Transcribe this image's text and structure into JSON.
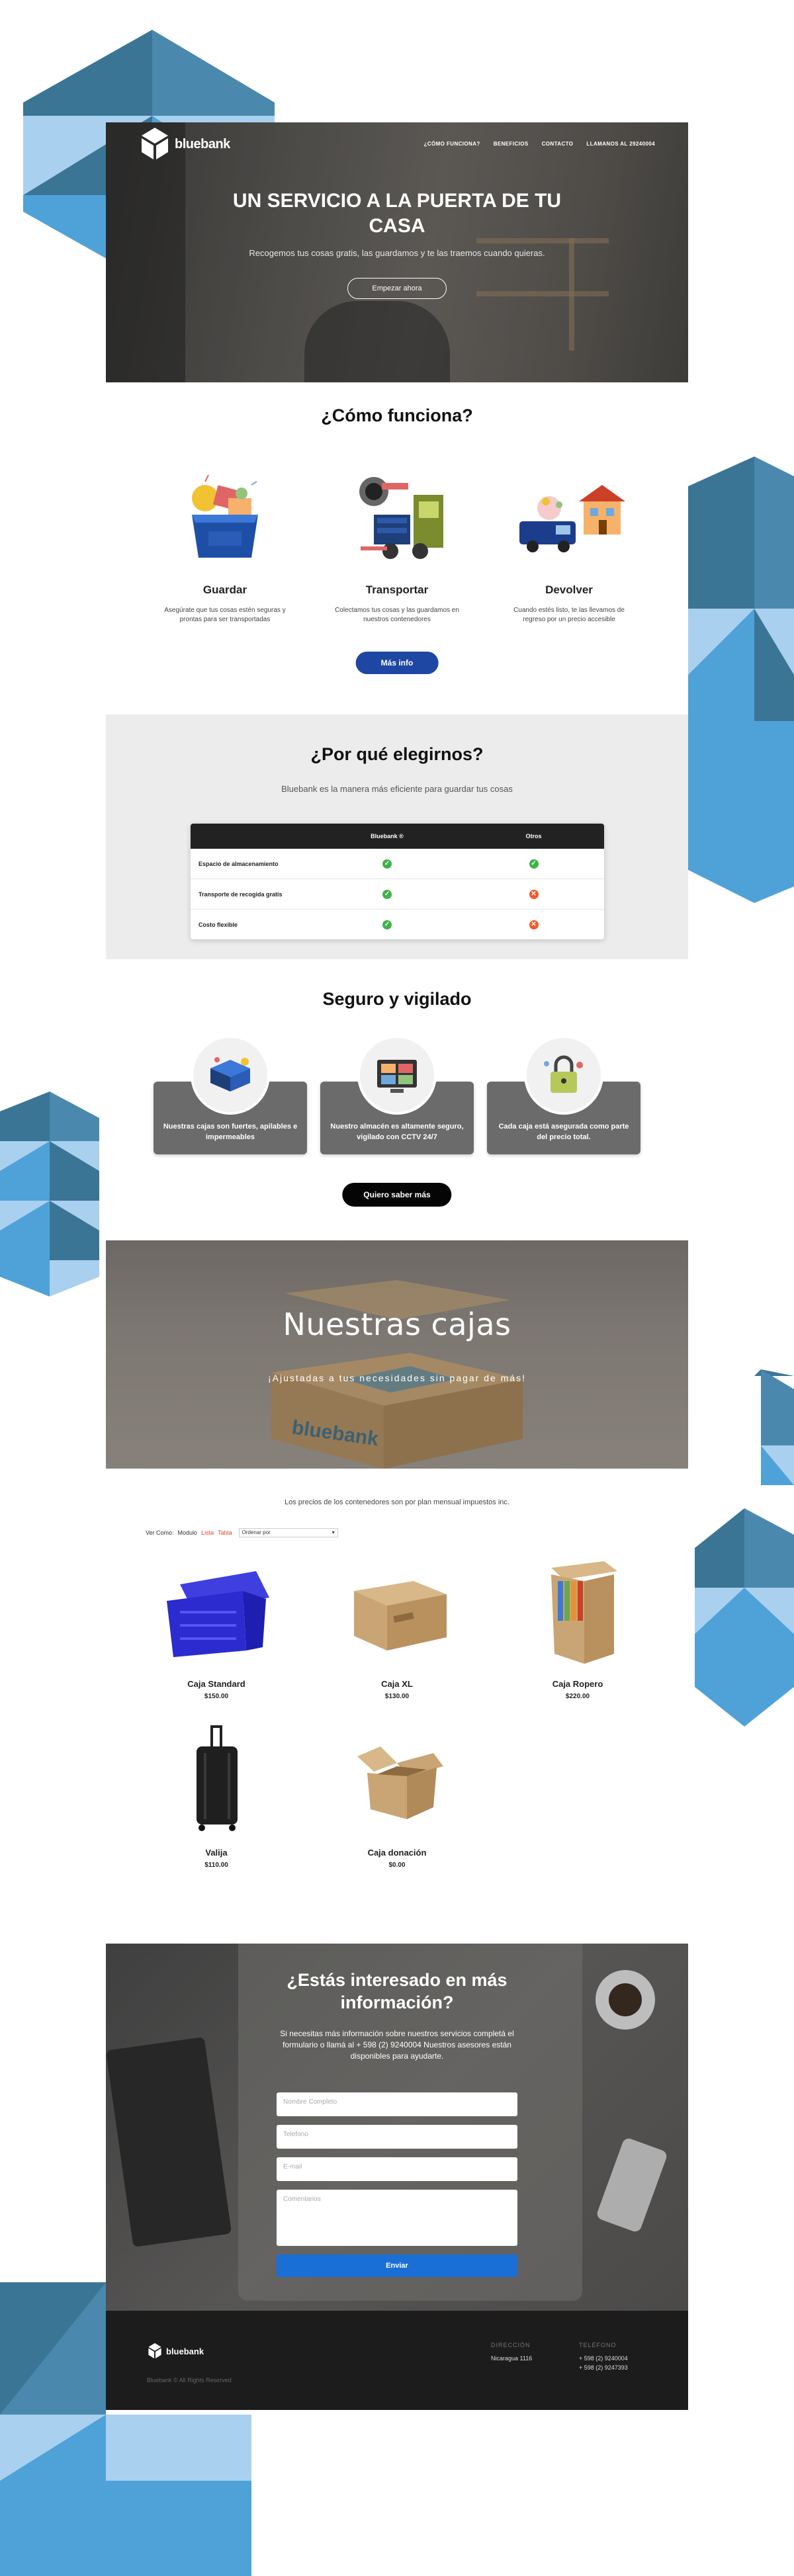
{
  "brand": {
    "name": "bluebank"
  },
  "nav": {
    "items": [
      "¿CÓMO FUNCIONA?",
      "BENEFICIOS",
      "CONTACTO",
      "LLAMANOS AL 29240004"
    ]
  },
  "hero": {
    "title": "UN SERVICIO A LA PUERTA DE TU CASA",
    "subtitle": "Recogemos tus cosas gratis, las guardamos y te las traemos cuando quieras.",
    "cta": "Empezar ahora"
  },
  "how": {
    "title": "¿Cómo funciona?",
    "steps": [
      {
        "title": "Guardar",
        "text": "Asegúrate que tus cosas estén seguras y prontas para ser transportadas"
      },
      {
        "title": "Transportar",
        "text": "Colectamos tus cosas y las guardamos en nuestros contenedores"
      },
      {
        "title": "Devolver",
        "text": "Cuando estés listo, te las llevamos de regreso por un precio accesible"
      }
    ],
    "cta": "Más info"
  },
  "why": {
    "title": "¿Por qué elegirnos?",
    "subtitle": "Bluebank es la manera más eficiente para guardar tus cosas",
    "columns": [
      "",
      "Bluebank ®",
      "Otros"
    ],
    "rows": [
      {
        "label": "Espacio de almacenamiento",
        "bluebank": true,
        "otros": true
      },
      {
        "label": "Transporte de recogida gratis",
        "bluebank": true,
        "otros": false
      },
      {
        "label": "Costo flexible",
        "bluebank": true,
        "otros": false
      }
    ]
  },
  "secure": {
    "title": "Seguro y vigilado",
    "cards": [
      {
        "text": "Nuestras cajas son fuertes, apilables e impermeables"
      },
      {
        "text": "Nuestro almacén es altamente seguro, vigilado con CCTV 24/7"
      },
      {
        "text": "Cada caja está asegurada como parte del precio total."
      }
    ],
    "cta": "Quiero saber más"
  },
  "boxes": {
    "title": "Nuestras cajas",
    "subtitle": "¡Ajustadas a tus necesidades sin pagar de más!",
    "box_label": "bluebank"
  },
  "shop": {
    "note": "Los precios de los contenedores son por plan mensual impuestos inc.",
    "view_label": "Ver Como:",
    "view_options": [
      "Modulo",
      "Lista",
      "Tabla"
    ],
    "sort_label": "Ordenar por",
    "products": [
      {
        "name": "Caja Standard",
        "price": "$150.00"
      },
      {
        "name": "Caja XL",
        "price": "$130.00"
      },
      {
        "name": "Caja Ropero",
        "price": "$220.00"
      },
      {
        "name": "Valija",
        "price": "$110.00"
      },
      {
        "name": "Caja donación",
        "price": "$0.00"
      }
    ]
  },
  "contact": {
    "title": "¿Estás interesado en más información?",
    "text": "Si necesitas más información sobre nuestros servicios completá el formulario o llamá al + 598 (2) 9240004 Nuestros asesores están disponibles para ayudarte.",
    "fields": {
      "name": "Nombre Completo",
      "phone": "Telefono",
      "email": "E-mail",
      "comments": "Comentarios"
    },
    "submit": "Enviar"
  },
  "footer": {
    "copyright": "Bluebank © All Rights Reserved",
    "address_heading": "DIRECCIÓN",
    "address": "Nicaragua 1116",
    "phone_heading": "TELÉFONO",
    "phones": [
      "+ 598 (2) 9240004",
      "+ 598 (2) 9247393"
    ]
  },
  "colors": {
    "accent_blue": "#1e47a3",
    "deco_blue_dark": "#3a7595",
    "deco_blue_mid": "#4fa2d8",
    "deco_blue_light": "#a9d0ef",
    "check_green": "#3fb34a",
    "cross_orange": "#ef5b2d",
    "footer_bg": "#1c1c1c"
  }
}
